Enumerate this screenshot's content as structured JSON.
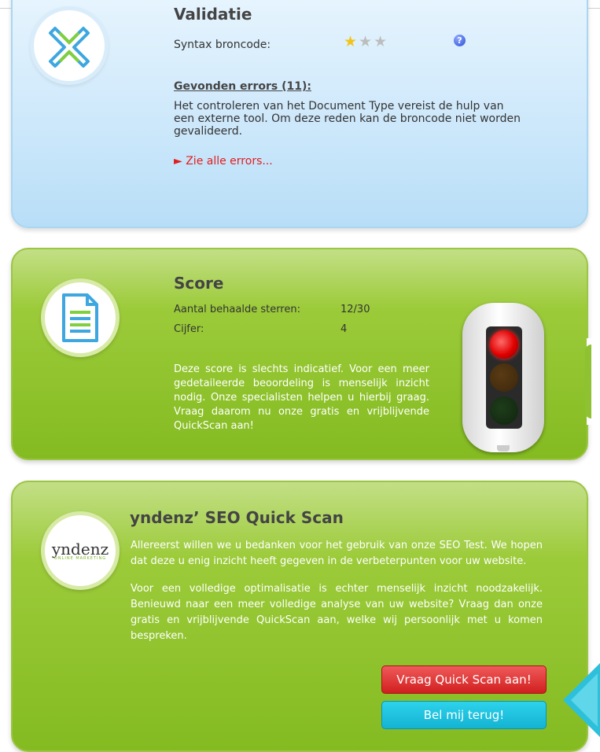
{
  "validation": {
    "title": "Validatie",
    "syntax_label": "Syntax broncode:",
    "rating": {
      "value": 1,
      "max": 3
    },
    "help_icon": "?",
    "errors_title": "Gevonden errors (11):",
    "errors_text": "Het controleren van het Document Type vereist de hulp van een externe tool. Om deze reden kan de broncode niet worden gevalideerd.",
    "see_all_link": "► Zie alle errors..."
  },
  "score": {
    "title": "Score",
    "stars_label": "Aantal behaalde sterren:",
    "stars_value": "12/30",
    "grade_label": "Cijfer:",
    "grade_value": "4",
    "description": "Deze score is slechts indicatief. Voor een meer gedetaileerde beoordeling is menselijk inzicht nodig. Onze specialisten helpen u hierbij graag. Vraag daarom nu onze gratis en vrijblijvende QuickScan aan!",
    "traffic_light_state": "red"
  },
  "seo": {
    "title": "yndenz’ SEO Quick Scan",
    "logo_text": "yndenz",
    "logo_sub": "ONLINE MARKETING",
    "paragraph1": "Allereerst willen we u bedanken voor het gebruik van onze SEO Test. We hopen dat deze u enig inzicht heeft gegeven in de verbeterpunten voor uw website.",
    "paragraph2": "Voor een volledige optimalisatie is echter menselijk inzicht noodzakelijk. Benieuwd naar een meer volledige analyse van uw website? Vraag dan onze gratis en vrijblijvende QuickScan aan, welke wij persoonlijk met u komen bespreken.",
    "btn_quickscan": "Vraag Quick Scan aan!",
    "btn_callback": "Bel mij terug!"
  },
  "colors": {
    "blue_panel": "#cfe9fb",
    "green_panel": "#9ccb3a",
    "red_button": "#d11f1f",
    "cyan_button": "#14b3d2",
    "link_red": "#e02020"
  }
}
